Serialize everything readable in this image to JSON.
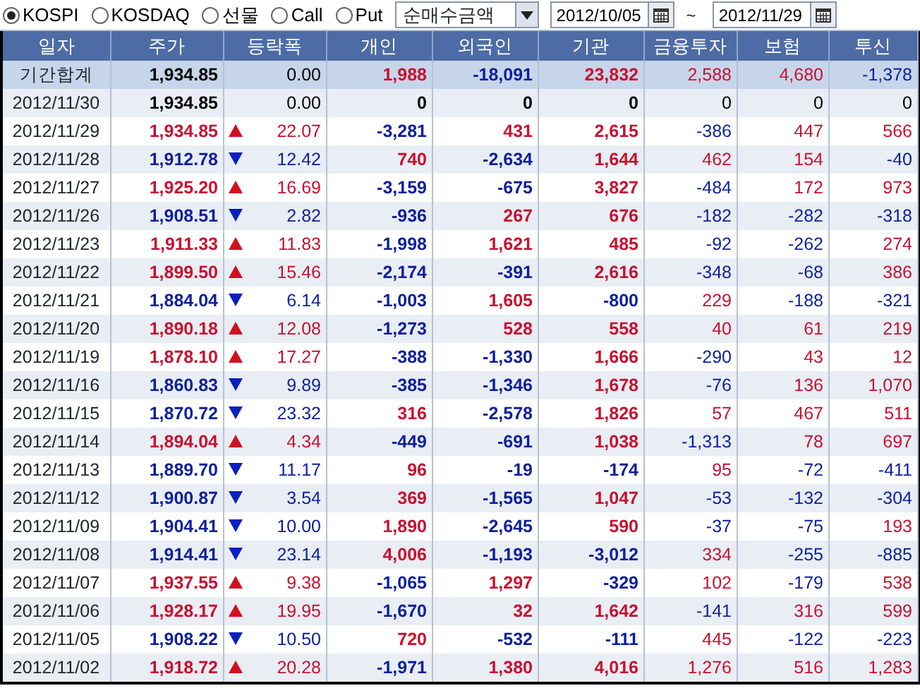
{
  "market_options": [
    {
      "label": "KOSPI",
      "selected": true
    },
    {
      "label": "KOSDAQ",
      "selected": false
    },
    {
      "label": "선물",
      "selected": false
    },
    {
      "label": "Call",
      "selected": false
    },
    {
      "label": "Put",
      "selected": false
    }
  ],
  "measure_select": {
    "value": "순매수금액"
  },
  "date_from": {
    "value": "2012/10/05"
  },
  "date_separator": "~",
  "date_to": {
    "value": "2012/11/29"
  },
  "table": {
    "columns": [
      "일자",
      "주가",
      "등락폭",
      "개인",
      "외국인",
      "기관",
      "금융투자",
      "보험",
      "투신"
    ],
    "rows": [
      {
        "kind": "total",
        "rising": false,
        "falling": false,
        "cells": [
          "기간합계",
          "1,934.85",
          "0.00",
          "1,988",
          "-18,091",
          "23,832",
          "2,588",
          "4,680",
          "-1,378"
        ]
      },
      {
        "kind": "day",
        "rising": false,
        "falling": false,
        "cells": [
          "2012/11/30",
          "1,934.85",
          "0.00",
          "0",
          "0",
          "0",
          "0",
          "0",
          "0"
        ]
      },
      {
        "kind": "day",
        "rising": true,
        "falling": false,
        "cells": [
          "2012/11/29",
          "1,934.85",
          "22.07",
          "-3,281",
          "431",
          "2,615",
          "-386",
          "447",
          "566"
        ]
      },
      {
        "kind": "day",
        "rising": false,
        "falling": true,
        "cells": [
          "2012/11/28",
          "1,912.78",
          "12.42",
          "740",
          "-2,634",
          "1,644",
          "462",
          "154",
          "-40"
        ]
      },
      {
        "kind": "day",
        "rising": true,
        "falling": false,
        "cells": [
          "2012/11/27",
          "1,925.20",
          "16.69",
          "-3,159",
          "-675",
          "3,827",
          "-484",
          "172",
          "973"
        ]
      },
      {
        "kind": "day",
        "rising": false,
        "falling": true,
        "cells": [
          "2012/11/26",
          "1,908.51",
          "2.82",
          "-936",
          "267",
          "676",
          "-182",
          "-282",
          "-318"
        ]
      },
      {
        "kind": "day",
        "rising": true,
        "falling": false,
        "cells": [
          "2012/11/23",
          "1,911.33",
          "11.83",
          "-1,998",
          "1,621",
          "485",
          "-92",
          "-262",
          "274"
        ]
      },
      {
        "kind": "day",
        "rising": true,
        "falling": false,
        "cells": [
          "2012/11/22",
          "1,899.50",
          "15.46",
          "-2,174",
          "-391",
          "2,616",
          "-348",
          "-68",
          "386"
        ]
      },
      {
        "kind": "day",
        "rising": false,
        "falling": true,
        "cells": [
          "2012/11/21",
          "1,884.04",
          "6.14",
          "-1,003",
          "1,605",
          "-800",
          "229",
          "-188",
          "-321"
        ]
      },
      {
        "kind": "day",
        "rising": true,
        "falling": false,
        "cells": [
          "2012/11/20",
          "1,890.18",
          "12.08",
          "-1,273",
          "528",
          "558",
          "40",
          "61",
          "219"
        ]
      },
      {
        "kind": "day",
        "rising": true,
        "falling": false,
        "cells": [
          "2012/11/19",
          "1,878.10",
          "17.27",
          "-388",
          "-1,330",
          "1,666",
          "-290",
          "43",
          "12"
        ]
      },
      {
        "kind": "day",
        "rising": false,
        "falling": true,
        "cells": [
          "2012/11/16",
          "1,860.83",
          "9.89",
          "-385",
          "-1,346",
          "1,678",
          "-76",
          "136",
          "1,070"
        ]
      },
      {
        "kind": "day",
        "rising": false,
        "falling": true,
        "cells": [
          "2012/11/15",
          "1,870.72",
          "23.32",
          "316",
          "-2,578",
          "1,826",
          "57",
          "467",
          "511"
        ]
      },
      {
        "kind": "day",
        "rising": true,
        "falling": false,
        "cells": [
          "2012/11/14",
          "1,894.04",
          "4.34",
          "-449",
          "-691",
          "1,038",
          "-1,313",
          "78",
          "697"
        ]
      },
      {
        "kind": "day",
        "rising": false,
        "falling": true,
        "cells": [
          "2012/11/13",
          "1,889.70",
          "11.17",
          "96",
          "-19",
          "-174",
          "95",
          "-72",
          "-411"
        ]
      },
      {
        "kind": "day",
        "rising": false,
        "falling": true,
        "cells": [
          "2012/11/12",
          "1,900.87",
          "3.54",
          "369",
          "-1,565",
          "1,047",
          "-53",
          "-132",
          "-304"
        ]
      },
      {
        "kind": "day",
        "rising": false,
        "falling": true,
        "cells": [
          "2012/11/09",
          "1,904.41",
          "10.00",
          "1,890",
          "-2,645",
          "590",
          "-37",
          "-75",
          "193"
        ]
      },
      {
        "kind": "day",
        "rising": false,
        "falling": true,
        "cells": [
          "2012/11/08",
          "1,914.41",
          "23.14",
          "4,006",
          "-1,193",
          "-3,012",
          "334",
          "-255",
          "-885"
        ]
      },
      {
        "kind": "day",
        "rising": true,
        "falling": false,
        "cells": [
          "2012/11/07",
          "1,937.55",
          "9.38",
          "-1,065",
          "1,297",
          "-329",
          "102",
          "-179",
          "538"
        ]
      },
      {
        "kind": "day",
        "rising": true,
        "falling": false,
        "cells": [
          "2012/11/06",
          "1,928.17",
          "19.95",
          "-1,670",
          "32",
          "1,642",
          "-141",
          "316",
          "599"
        ]
      },
      {
        "kind": "day",
        "rising": false,
        "falling": true,
        "cells": [
          "2012/11/05",
          "1,908.22",
          "10.50",
          "720",
          "-532",
          "-111",
          "445",
          "-122",
          "-223"
        ]
      },
      {
        "kind": "day",
        "rising": true,
        "falling": false,
        "cells": [
          "2012/11/02",
          "1,918.72",
          "20.28",
          "-1,971",
          "1,380",
          "4,016",
          "1,276",
          "516",
          "1,283"
        ]
      }
    ]
  }
}
